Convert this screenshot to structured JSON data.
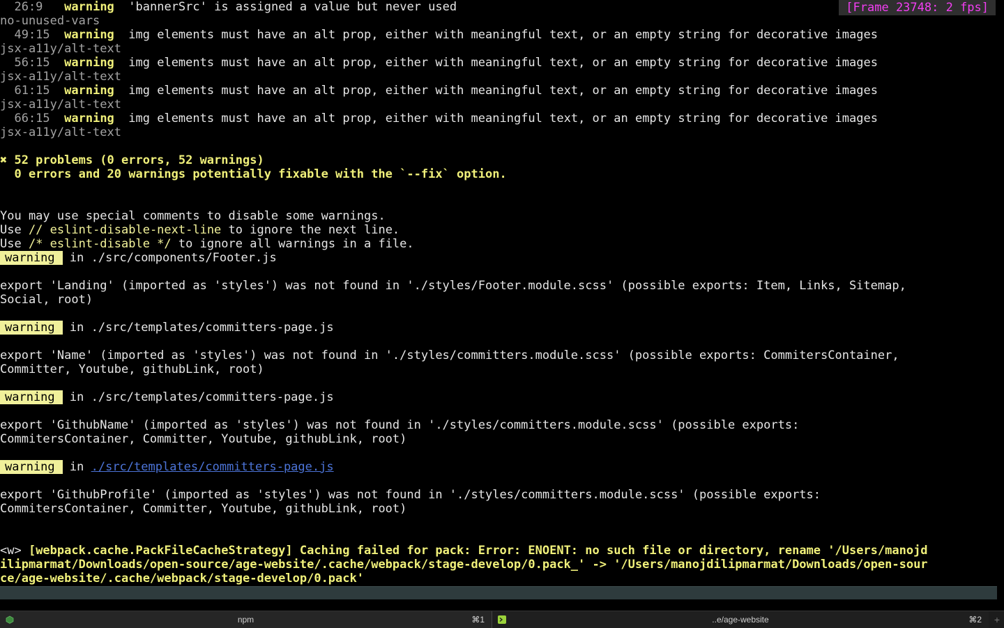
{
  "frame_indicator": "[Frame 23748: 2 fps]",
  "lint_items": [
    {
      "loc": "  26:9 ",
      "level": "warning",
      "message": "'bannerSrc' is assigned a value but never used",
      "rule": "no-unused-vars"
    },
    {
      "loc": "  49:15",
      "level": "warning",
      "message": "img elements must have an alt prop, either with meaningful text, or an empty string for decorative images",
      "rule": "jsx-a11y/alt-text"
    },
    {
      "loc": "  56:15",
      "level": "warning",
      "message": "img elements must have an alt prop, either with meaningful text, or an empty string for decorative images",
      "rule": "jsx-a11y/alt-text"
    },
    {
      "loc": "  61:15",
      "level": "warning",
      "message": "img elements must have an alt prop, either with meaningful text, or an empty string for decorative images",
      "rule": "jsx-a11y/alt-text"
    },
    {
      "loc": "  66:15",
      "level": "warning",
      "message": "img elements must have an alt prop, either with meaningful text, or an empty string for decorative images",
      "rule": "jsx-a11y/alt-text"
    }
  ],
  "summary": {
    "problems": "✖ 52 problems (0 errors, 52 warnings)",
    "fixable": "  0 errors and 20 warnings potentially fixable with the `--fix` option."
  },
  "hint": {
    "line1": "You may use special comments to disable some warnings.",
    "use": "Use ",
    "next_line_comment": "// eslint-disable-next-line",
    "next_line_rest": " to ignore the next line.",
    "file_comment": "/* eslint-disable */",
    "file_rest": " to ignore all warnings in a file."
  },
  "warning_badge": "warning",
  "in_label": " in ",
  "webpack_warnings": [
    {
      "file": "./src/components/Footer.js",
      "link": false,
      "lines": [
        "export 'Landing' (imported as 'styles') was not found in './styles/Footer.module.scss' (possible exports: Item, Links, Sitemap,",
        "Social, root)"
      ]
    },
    {
      "file": "./src/templates/committers-page.js",
      "link": false,
      "lines": [
        "export 'Name' (imported as 'styles') was not found in './styles/committers.module.scss' (possible exports: CommitersContainer,",
        "Committer, Youtube, githubLink, root)"
      ]
    },
    {
      "file": "./src/templates/committers-page.js",
      "link": false,
      "lines": [
        "export 'GithubName' (imported as 'styles') was not found in './styles/committers.module.scss' (possible exports:",
        "CommitersContainer, Committer, Youtube, githubLink, root)"
      ]
    },
    {
      "file": "./src/templates/committers-page.js",
      "link": true,
      "lines": [
        "export 'GithubProfile' (imported as 'styles') was not found in './styles/committers.module.scss' (possible exports:",
        "CommitersContainer, Committer, Youtube, githubLink, root)"
      ]
    }
  ],
  "cache_error": {
    "prefix": "<w> ",
    "lines": [
      "[webpack.cache.PackFileCacheStrategy] Caching failed for pack: Error: ENOENT: no such file or directory, rename '/Users/manojd",
      "ilipmarmat/Downloads/open-source/age-website/.cache/webpack/stage-develop/0.pack_' -> '/Users/manojdilipmarmat/Downloads/open-sour",
      "ce/age-website/.cache/webpack/stage-develop/0.pack'"
    ]
  },
  "tabs": [
    {
      "title": "npm",
      "shortcut": "⌘1",
      "icon": "terminal-icon"
    },
    {
      "title": "..e/age-website",
      "shortcut": "⌘2",
      "icon": "terminal-icon"
    }
  ],
  "colors": {
    "warning": "#f0f07a",
    "link": "#4c74d8",
    "frame": "#f23ef2",
    "bg": "#000000"
  }
}
